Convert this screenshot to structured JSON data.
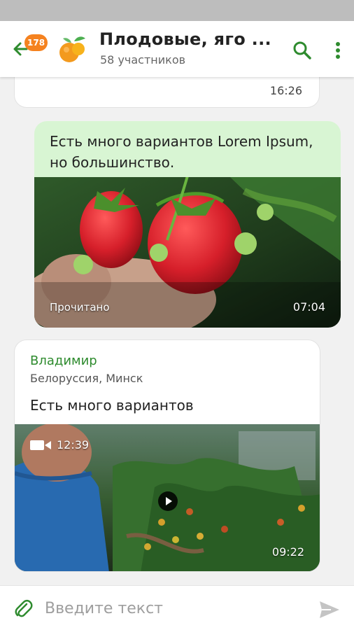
{
  "header": {
    "back_badge": "178",
    "title": "Плодовые, яго ...",
    "subtitle": "58 участников",
    "search_icon": "search-icon",
    "more_icon": "more-vertical-icon",
    "accent_color": "#2e8b2e"
  },
  "messages": [
    {
      "time": "16:26"
    },
    {
      "text": "Есть много вариантов Lorem Ipsum, но большинство.",
      "status": "Прочитано",
      "time": "07:04",
      "media": "photo-strawberries"
    },
    {
      "author": "Владимир",
      "location": "Белоруссия, Минск",
      "text": "Есть много вариантов",
      "video_duration": "12:39",
      "time": "09:22",
      "media": "video-greenhouse"
    }
  ],
  "composer": {
    "placeholder": "Введите текст",
    "attach_icon": "paperclip-icon",
    "send_icon": "send-icon"
  }
}
